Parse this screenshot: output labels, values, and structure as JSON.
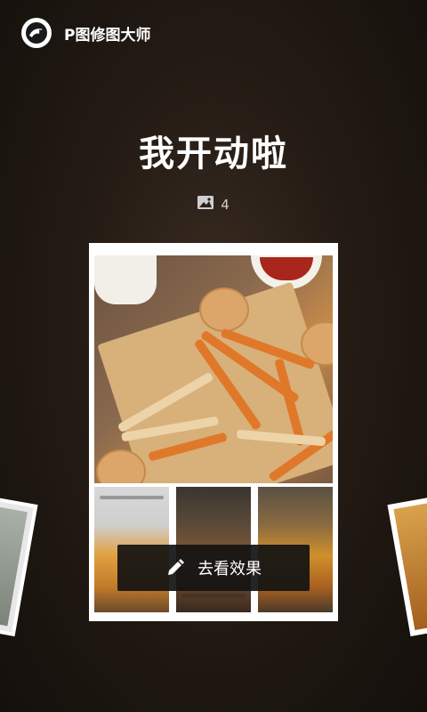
{
  "header": {
    "app_name": "P图修图大师",
    "logo_icon": "bird-logo-icon"
  },
  "main": {
    "title": "我开动啦",
    "image_count_icon": "image-icon",
    "image_count": "4",
    "action_button": {
      "label": "去看效果",
      "icon": "pencil-icon"
    }
  },
  "colors": {
    "background": "#241b14",
    "text": "#ffffff",
    "button_bg": "#121212",
    "card_bg": "#ffffff"
  }
}
